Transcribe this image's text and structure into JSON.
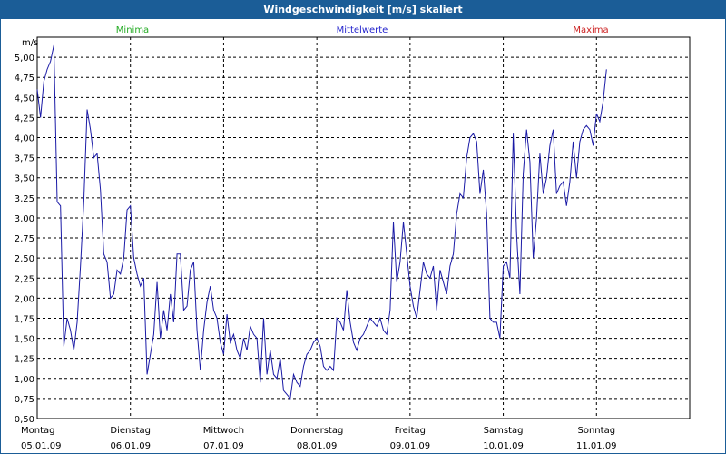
{
  "window": {
    "title": "Windgeschwindigkeit [m/s] skaliert"
  },
  "colors": {
    "title_bg": "#1b5d97",
    "line": "#1a1aa6",
    "minima": "#22aa22",
    "mittelwerte": "#2222cc",
    "maxima": "#cc2222",
    "grid": "#000000"
  },
  "chart_data": {
    "type": "line",
    "title": "Windgeschwindigkeit [m/s] skaliert",
    "ylabel": "m/s",
    "xlabel": "",
    "ylim": [
      0.5,
      5.25
    ],
    "y_ticks": [
      "5,00",
      "4,75",
      "4,50",
      "4,25",
      "4,00",
      "3,75",
      "3,50",
      "3,25",
      "3,00",
      "2,75",
      "2,50",
      "2,25",
      "2,00",
      "1,75",
      "1,50",
      "1,25",
      "1,00",
      "0,75",
      "0,50"
    ],
    "y_tick_values": [
      5.0,
      4.75,
      4.5,
      4.25,
      4.0,
      3.75,
      3.5,
      3.25,
      3.0,
      2.75,
      2.5,
      2.25,
      2.0,
      1.75,
      1.5,
      1.25,
      1.0,
      0.75,
      0.5
    ],
    "x_ticks": [
      {
        "day": "Montag",
        "date": "05.01.09"
      },
      {
        "day": "Dienstag",
        "date": "06.01.09"
      },
      {
        "day": "Mittwoch",
        "date": "07.01.09"
      },
      {
        "day": "Donnerstag",
        "date": "08.01.09"
      },
      {
        "day": "Freitag",
        "date": "09.01.09"
      },
      {
        "day": "Samstag",
        "date": "10.01.09"
      },
      {
        "day": "Sonntag",
        "date": "11.01.09"
      }
    ],
    "grid": true,
    "legend": [
      {
        "name": "Minima",
        "color": "#22aa22"
      },
      {
        "name": "Mittelwerte",
        "color": "#2222cc"
      },
      {
        "name": "Maxima",
        "color": "#cc2222"
      }
    ],
    "series": [
      {
        "name": "Mittelwerte",
        "x_days": [
          0,
          0.0357,
          0.0714,
          0.1071,
          0.1429,
          0.1786,
          0.2143,
          0.25,
          0.2857,
          0.3214,
          0.3571,
          0.3929,
          0.4286,
          0.4643,
          0.5,
          0.5357,
          0.5714,
          0.6071,
          0.6429,
          0.6786,
          0.7143,
          0.75,
          0.7857,
          0.8214,
          0.8571,
          0.8929,
          0.9286,
          0.9643,
          1,
          1.0357,
          1.0714,
          1.1071,
          1.1429,
          1.1786,
          1.2143,
          1.25,
          1.2857,
          1.3214,
          1.3571,
          1.3929,
          1.4286,
          1.4643,
          1.5,
          1.5357,
          1.5714,
          1.6071,
          1.6429,
          1.6786,
          1.7143,
          1.75,
          1.7857,
          1.8214,
          1.8571,
          1.8929,
          1.9286,
          1.9643,
          2,
          2.0357,
          2.0714,
          2.1071,
          2.1429,
          2.1786,
          2.2143,
          2.25,
          2.2857,
          2.3214,
          2.3571,
          2.3929,
          2.4286,
          2.4643,
          2.5,
          2.5357,
          2.5714,
          2.6071,
          2.6429,
          2.6786,
          2.7143,
          2.75,
          2.7857,
          2.8214,
          2.8571,
          2.8929,
          2.9286,
          2.9643,
          3,
          3.0357,
          3.0714,
          3.1071,
          3.1429,
          3.1786,
          3.2143,
          3.25,
          3.2857,
          3.3214,
          3.3571,
          3.3929,
          3.4286,
          3.4643,
          3.5,
          3.5357,
          3.5714,
          3.6071,
          3.6429,
          3.6786,
          3.7143,
          3.75,
          3.7857,
          3.8214,
          3.8571,
          3.8929,
          3.9286,
          3.9643,
          4,
          4.0357,
          4.0714,
          4.1071,
          4.1429,
          4.1786,
          4.2143,
          4.25,
          4.2857,
          4.3214,
          4.3571,
          4.3929,
          4.4286,
          4.4643,
          4.5,
          4.5357,
          4.5714,
          4.6071,
          4.6429,
          4.6786,
          4.7143,
          4.75,
          4.7857,
          4.8214,
          4.8571,
          4.8929,
          4.9286,
          4.9643,
          5,
          5.0357,
          5.0714,
          5.1071,
          5.1429,
          5.1786,
          5.2143,
          5.25,
          5.2857,
          5.3214,
          5.3571,
          5.3929,
          5.4286,
          5.4643,
          5.5,
          5.5357,
          5.5714,
          5.6071,
          5.6429,
          5.6786,
          5.7143,
          5.75,
          5.7857,
          5.8214,
          5.8571,
          5.8929,
          5.9286,
          5.9643,
          6,
          6.0357,
          6.0714,
          6.1071,
          6.1429,
          6.1786,
          6.2143,
          6.25,
          6.2857,
          6.3214,
          6.3571,
          6.3929,
          6.4286,
          6.4643,
          6.5,
          6.5357,
          6.5714,
          6.6071,
          6.6429,
          6.6786,
          6.7143,
          6.75,
          6.7857,
          6.8214,
          6.8571,
          6.8929,
          6.9286,
          6.9643
        ],
        "values": [
          4.6,
          4.25,
          4.7,
          4.85,
          4.95,
          5.15,
          3.2,
          3.15,
          1.4,
          1.75,
          1.6,
          1.35,
          1.7,
          2.4,
          3.2,
          4.35,
          4.1,
          3.75,
          3.8,
          3.35,
          2.55,
          2.45,
          2.0,
          2.05,
          2.35,
          2.3,
          2.5,
          3.1,
          3.15,
          2.5,
          2.3,
          2.15,
          2.25,
          1.05,
          1.3,
          1.55,
          2.2,
          1.5,
          1.85,
          1.6,
          2.05,
          1.7,
          2.55,
          2.55,
          1.85,
          1.9,
          2.35,
          2.45,
          1.6,
          1.1,
          1.6,
          1.95,
          2.15,
          1.85,
          1.75,
          1.45,
          1.3,
          1.8,
          1.45,
          1.55,
          1.35,
          1.25,
          1.5,
          1.35,
          1.65,
          1.55,
          1.5,
          0.95,
          1.75,
          1.05,
          1.35,
          1.05,
          1.0,
          1.25,
          0.85,
          0.8,
          0.75,
          1.05,
          0.95,
          0.9,
          1.15,
          1.3,
          1.35,
          1.45,
          1.5,
          1.4,
          1.15,
          1.1,
          1.15,
          1.1,
          1.75,
          1.7,
          1.6,
          2.1,
          1.7,
          1.45,
          1.35,
          1.5,
          1.55,
          1.65,
          1.75,
          1.7,
          1.65,
          1.75,
          1.6,
          1.55,
          1.85,
          2.95,
          2.2,
          2.45,
          2.95,
          2.55,
          2.15,
          1.9,
          1.75,
          2.1,
          2.45,
          2.3,
          2.25,
          2.4,
          1.85,
          2.35,
          2.2,
          2.05,
          2.4,
          2.55,
          3.05,
          3.3,
          3.25,
          3.75,
          4.0,
          4.05,
          3.95,
          3.3,
          3.6,
          3.05,
          1.75,
          1.7,
          1.7,
          1.5,
          2.4,
          2.45,
          2.25,
          4.05,
          2.8,
          2.05,
          3.55,
          4.1,
          3.7,
          2.5,
          3.0,
          3.8,
          3.3,
          3.5,
          3.9,
          4.1,
          3.3,
          3.4,
          3.45,
          3.15,
          3.45,
          3.95,
          3.5,
          3.95,
          4.1,
          4.15,
          4.1,
          3.9,
          4.3,
          4.2,
          4.45,
          4.85
        ]
      }
    ]
  }
}
